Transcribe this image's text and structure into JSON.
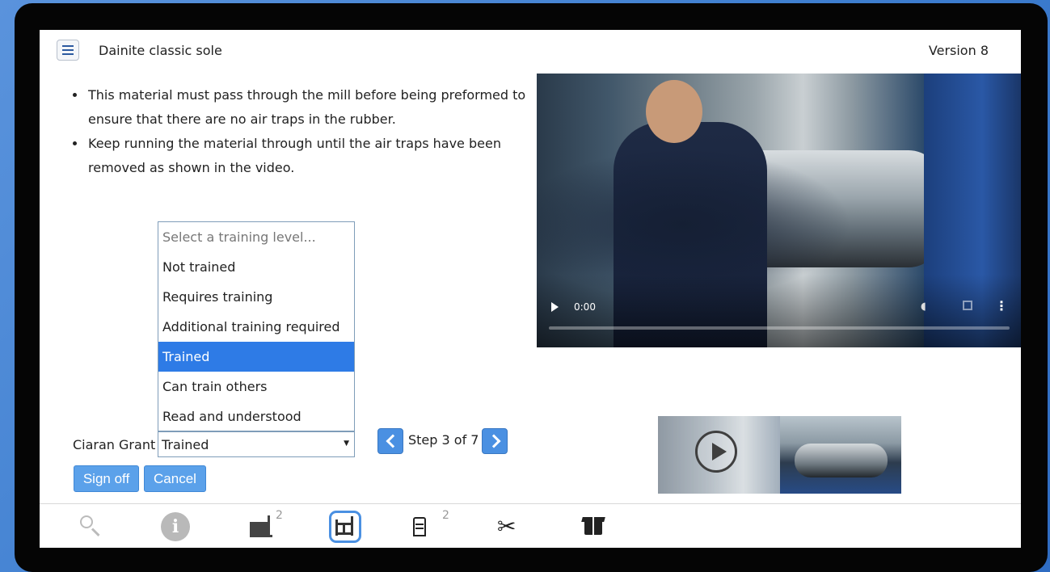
{
  "header": {
    "title": "Dainite classic sole",
    "version": "Version 8"
  },
  "instructions": [
    "This material must pass through the mill before being preformed to ensure that there are no air traps in the rubber.",
    "Keep running the material through until the air traps have been removed as shown in the video."
  ],
  "video": {
    "time": "0:00",
    "progress_fraction": 0
  },
  "training": {
    "user_name": "Ciaran Grant",
    "selected": "Trained",
    "options": [
      "Select a training level...",
      "Not trained",
      "Requires training",
      "Additional training required",
      "Trained",
      "Can train others",
      "Read and understood"
    ],
    "selected_index": 4
  },
  "step": {
    "label": "Step 3 of 7",
    "current": 3,
    "total": 7
  },
  "buttons": {
    "sign_off": "Sign off",
    "cancel": "Cancel"
  },
  "toolbar": {
    "icons": [
      "search-icon",
      "info-icon",
      "forklift-icon",
      "machine-icon",
      "station-icon",
      "scissors-icon",
      "box-icon"
    ],
    "forklift_count": "2",
    "station_count": "2",
    "active": "machine-icon"
  },
  "colors": {
    "accent": "#4a90e2",
    "selected_option": "#2e7be6",
    "button": "#5ba1ea"
  }
}
